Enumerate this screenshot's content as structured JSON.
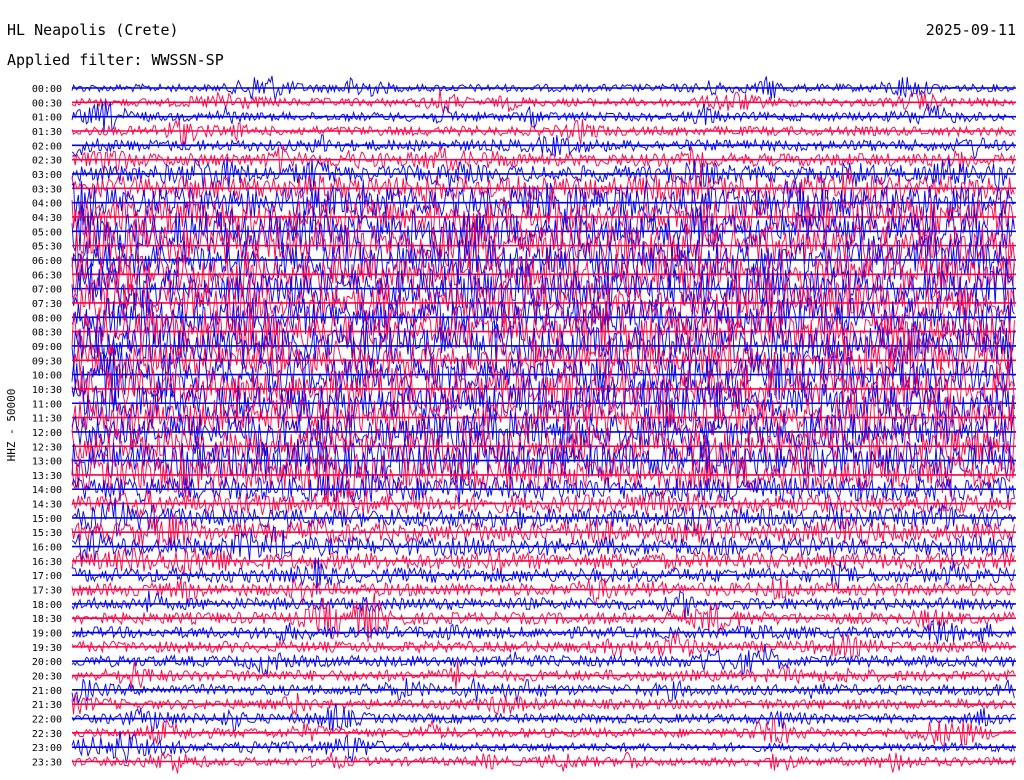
{
  "header": {
    "station": "HL Neapolis (Crete)",
    "date": "2025-09-11",
    "filter": "Applied filter: WWSSN-SP"
  },
  "chart_data": {
    "type": "line",
    "channel_label": "HHZ - 50000",
    "row_labels": [
      "00:00",
      "00:30",
      "01:00",
      "01:30",
      "02:00",
      "02:30",
      "03:00",
      "03:30",
      "04:00",
      "04:30",
      "05:00",
      "05:30",
      "06:00",
      "06:30",
      "07:00",
      "07:30",
      "08:00",
      "08:30",
      "09:00",
      "09:30",
      "10:00",
      "10:30",
      "11:00",
      "11:30",
      "12:00",
      "12:30",
      "13:00",
      "13:30",
      "14:00",
      "14:30",
      "15:00",
      "15:30",
      "16:00",
      "16:30",
      "17:00",
      "17:30",
      "18:00",
      "18:30",
      "19:00",
      "19:30",
      "20:00",
      "20:30",
      "21:00",
      "21:30",
      "22:00",
      "22:30",
      "23:00",
      "23:30"
    ],
    "noise_level": [
      0.15,
      0.17,
      0.18,
      0.2,
      0.25,
      0.3,
      0.4,
      0.6,
      0.8,
      0.9,
      1.0,
      1.0,
      1.0,
      1.0,
      1.0,
      1.0,
      1.0,
      1.0,
      1.0,
      0.95,
      0.95,
      0.95,
      0.95,
      0.95,
      0.95,
      0.95,
      0.95,
      0.85,
      0.6,
      0.45,
      0.45,
      0.45,
      0.45,
      0.4,
      0.35,
      0.3,
      0.28,
      0.27,
      0.26,
      0.25,
      0.25,
      0.25,
      0.23,
      0.22,
      0.2,
      0.2,
      0.18,
      0.18
    ],
    "series_colors": [
      "#0000ee",
      "#ff0044"
    ]
  }
}
